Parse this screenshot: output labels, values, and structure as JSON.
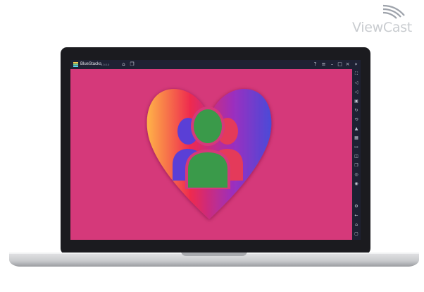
{
  "watermark": {
    "brand": "ViewCast"
  },
  "window": {
    "app_name": "BlueStacks",
    "version": "5.0.0.0",
    "title_icons": [
      "home-icon",
      "multi-instance-icon"
    ],
    "controls": [
      "help-icon",
      "menu-icon",
      "minimize-icon",
      "maximize-icon",
      "close-icon",
      "collapse-sidebar-icon"
    ]
  },
  "content": {
    "background": "#d5397a",
    "logo": "heart-with-users-logo",
    "gradient": [
      "#ffb347",
      "#ee2a4f",
      "#9a2fc0",
      "#4a4ad8"
    ],
    "users_colors": {
      "front": "#3a9a4a",
      "back_left": "#5a3fd6",
      "back_right": "#e43a5a"
    }
  },
  "sidebar": {
    "icons": [
      "fullscreen-icon",
      "volume-up-icon",
      "volume-down-icon",
      "screen-record-icon",
      "rotate-icon",
      "shake-icon",
      "install-apk-icon",
      "screenshot-icon",
      "folder-icon",
      "macro-icon",
      "multi-instance-icon",
      "eco-mode-icon",
      "location-icon",
      "settings-icon",
      "back-icon",
      "home-icon",
      "recent-apps-icon"
    ]
  }
}
